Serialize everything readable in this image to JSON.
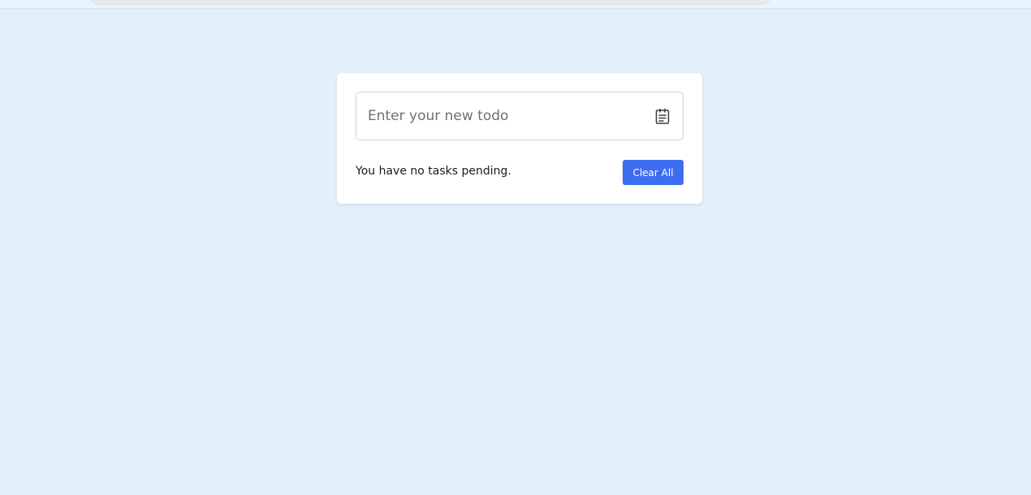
{
  "todo": {
    "input_placeholder": "Enter your new todo",
    "input_value": "",
    "input_icon": "clipboard-icon",
    "pending_message": "You have no tasks pending.",
    "clear_all_label": "Clear All"
  },
  "colors": {
    "page_background": "#e3f0fb",
    "card_background": "#ffffff",
    "accent": "#3d6df0"
  }
}
